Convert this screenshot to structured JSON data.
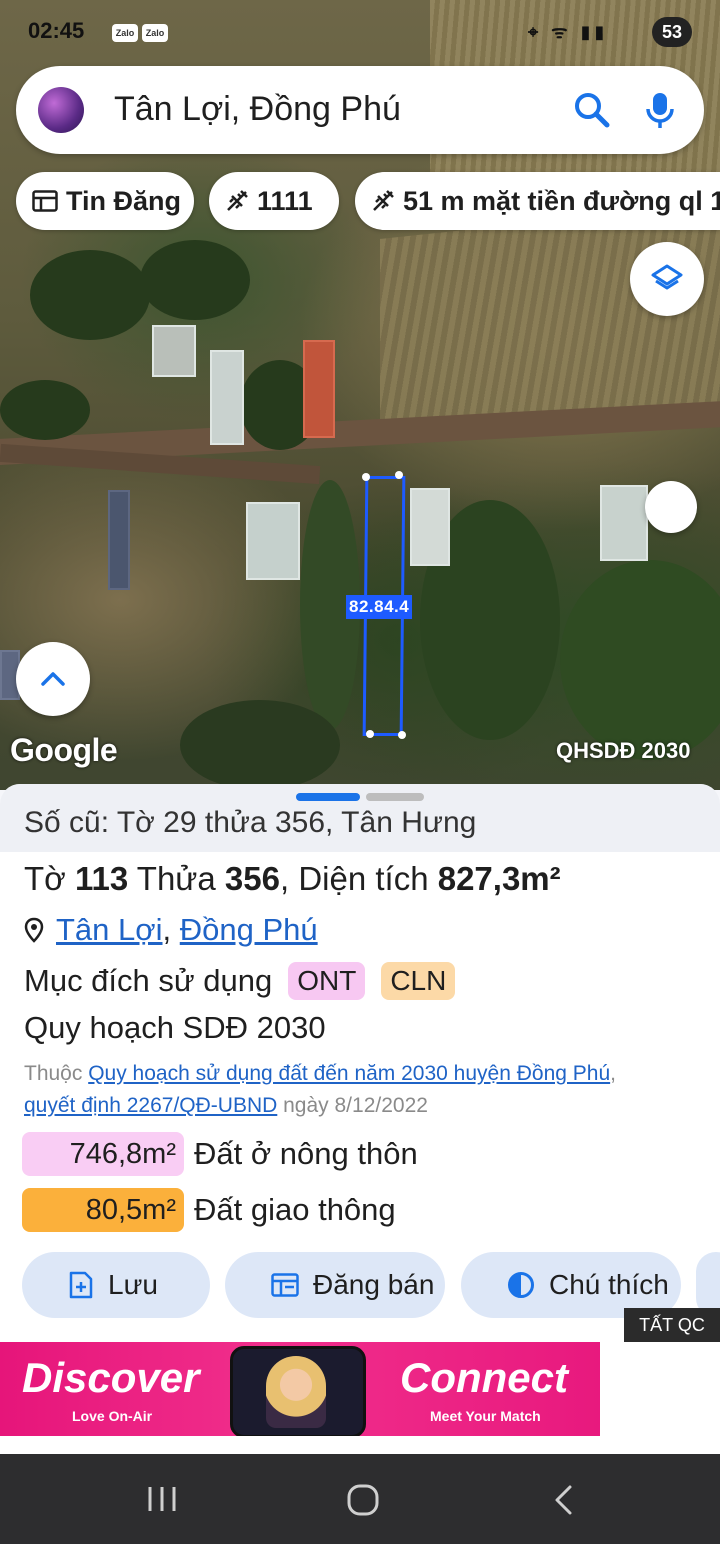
{
  "status": {
    "time": "02:45",
    "apps": [
      "Zalo",
      "Zalo"
    ],
    "battery": "53"
  },
  "search": {
    "query": "Tân Lợi, Đồng Phú"
  },
  "chips": [
    {
      "label": "Tin Đăng",
      "icon": "listing-icon"
    },
    {
      "label": "1111",
      "icon": "measure-icon"
    },
    {
      "label": "51 m mặt tiền đường ql 1",
      "icon": "measure-icon"
    }
  ],
  "map": {
    "parcel_label": "82.84.4",
    "brand": "Google",
    "layer_attribution": "QHSDĐ 2030",
    "parcel_color": "#1e5bff"
  },
  "sheet": {
    "old_parcel": "Số cũ: Tờ 29 thửa 356, Tân Hưng",
    "title": {
      "sheet_prefix": "Tờ ",
      "sheet_no": "113",
      "parcel_prefix": " Thửa ",
      "parcel_no": "356",
      "area_prefix": ", Diện tích ",
      "area": "827,3m²"
    },
    "location": {
      "commune": "Tân Lợi",
      "sep": ",",
      "district": "Đồng Phú"
    },
    "purpose": {
      "label": "Mục đích sử dụng",
      "tags": [
        {
          "code": "ONT",
          "color": "#f7c8f2"
        },
        {
          "code": "CLN",
          "color": "#fcd9a7"
        }
      ]
    },
    "plan": {
      "title": "Quy hoạch SDĐ 2030",
      "prefix": "Thuộc ",
      "link": "Quy hoạch sử dụng đất đến năm 2030 huyện Đồng Phú",
      "comma": ",",
      "decision": "quyết định 2267/QĐ-UBND",
      "date": " ngày 8/12/2022"
    },
    "areas": [
      {
        "value": "746,8m²",
        "label": "Đất ở nông thôn",
        "color": "#f9cdf4"
      },
      {
        "value": "80,5m²",
        "label": "Đất giao thông",
        "color": "#fbb03b"
      }
    ],
    "actions": [
      {
        "label": "Lưu",
        "icon": "bookmark-add-icon"
      },
      {
        "label": "Đăng bán",
        "icon": "listing-icon"
      },
      {
        "label": "Chú thích",
        "icon": "contrast-icon"
      }
    ],
    "ad_close": "TẤT QC"
  },
  "ad": {
    "left_title": "Discover",
    "left_sub": "Love On-Air",
    "right_title": "Connect",
    "right_sub": "Meet Your Match"
  },
  "colors": {
    "accent": "#1a73e8",
    "link": "#1f63c6",
    "button_bg": "#dde7f7"
  }
}
